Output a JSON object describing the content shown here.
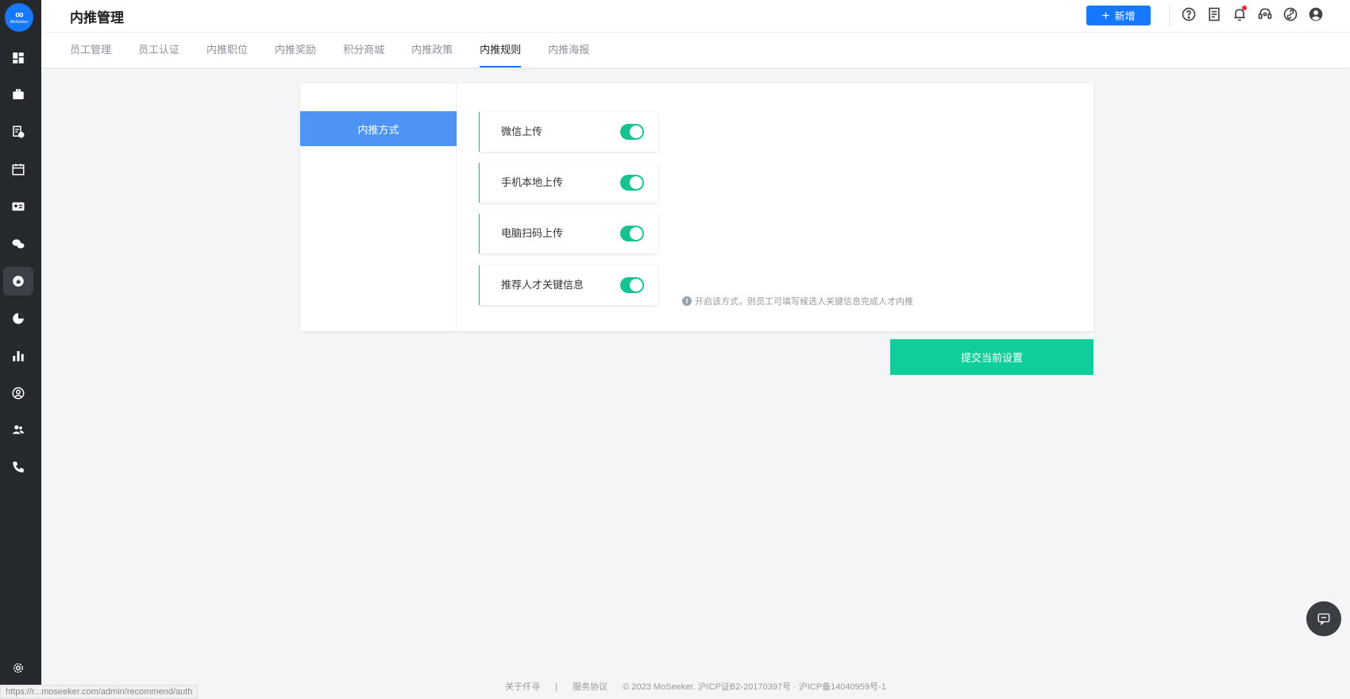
{
  "logo": {
    "text": "MoSeeker",
    "symbol": "∞"
  },
  "header": {
    "title": "内推管理",
    "add_label": "新增",
    "add_symbol": "+"
  },
  "tabs": [
    {
      "label": "员工管理",
      "active": false
    },
    {
      "label": "员工认证",
      "active": false
    },
    {
      "label": "内推职位",
      "active": false
    },
    {
      "label": "内推奖励",
      "active": false
    },
    {
      "label": "积分商城",
      "active": false
    },
    {
      "label": "内推政策",
      "active": false
    },
    {
      "label": "内推规则",
      "active": true
    },
    {
      "label": "内推海报",
      "active": false
    }
  ],
  "card": {
    "method_tab": "内推方式",
    "options": [
      {
        "label": "微信上传",
        "enabled": true
      },
      {
        "label": "手机本地上传",
        "enabled": true
      },
      {
        "label": "电脑扫码上传",
        "enabled": true
      },
      {
        "label": "推荐人才关键信息",
        "enabled": true
      }
    ],
    "hint": "开启该方式，则员工可填写候选人关键信息完成人才内推",
    "hint_icon": "i"
  },
  "submit_label": "提交当前设置",
  "footer": {
    "about": "关于仟寻",
    "sep": "|",
    "terms": "服务协议",
    "copyright": "© 2023 MoSeeker. 沪ICP证B2-20170397号 · 沪ICP备14040959号-1"
  },
  "status_url": "https://r...moseeker.com/admin/recommend/auth",
  "colors": {
    "primary": "#1677ff",
    "accent": "#0ecf9b",
    "toggle_on": "#17c391",
    "sidebar": "#25282d"
  }
}
